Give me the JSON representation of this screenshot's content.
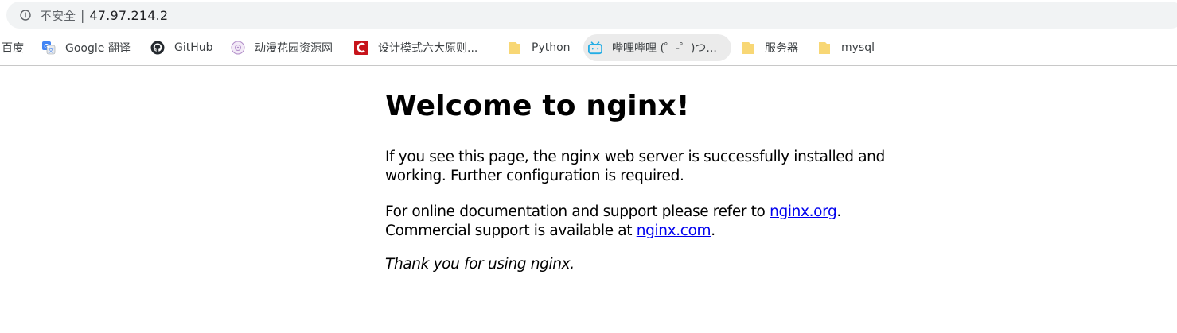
{
  "address_bar": {
    "security_label": "不安全",
    "separator": "|",
    "url": "47.97.214.2"
  },
  "bookmarks": [
    {
      "label": "百度",
      "icon": "baidu-icon"
    },
    {
      "label": "Google 翻译",
      "icon": "google-translate-icon"
    },
    {
      "label": "GitHub",
      "icon": "github-icon"
    },
    {
      "label": "动漫花园资源网",
      "icon": "dmhy-icon"
    },
    {
      "label": "设计模式六大原则...",
      "icon": "csdn-icon"
    },
    {
      "label": "Python",
      "icon": "folder-icon"
    },
    {
      "label": "哔哩哔哩 (゜-゜)つ...",
      "icon": "bilibili-icon"
    },
    {
      "label": "服务器",
      "icon": "folder-icon"
    },
    {
      "label": "mysql",
      "icon": "folder-icon"
    }
  ],
  "colors": {
    "link": "#0000ee",
    "folder": "#f8d775",
    "csdn": "#c7141b",
    "bilibili": "#23ade5",
    "google_translate": "#4285f4"
  },
  "page": {
    "title": "Welcome to nginx!",
    "p1_line1": "If you see this page, the nginx web server is successfully installed and",
    "p1_line2": "working. Further configuration is required.",
    "p2_prefix": "For online documentation and support please refer to ",
    "p2_link1": "nginx.org",
    "p2_mid": ".",
    "p2_line2_prefix": "Commercial support is available at ",
    "p2_link2": "nginx.com",
    "p2_suffix": ".",
    "p3": "Thank you for using nginx."
  }
}
